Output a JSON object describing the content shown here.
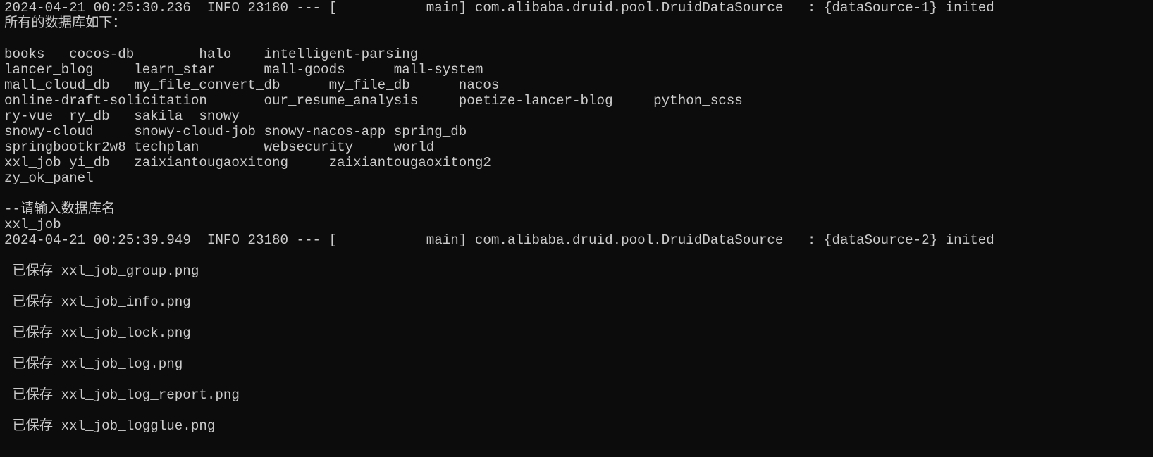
{
  "terminal": {
    "background": "#0c0c0c",
    "foreground": "#cccccc",
    "lines": [
      "2024-04-21 00:25:30.236  INFO 23180 --- [           main] com.alibaba.druid.pool.DruidDataSource   : {dataSource-1} inited",
      "所有的数据库如下：",
      "",
      "books   cocos-db        halo    intelligent-parsing",
      "lancer_blog     learn_star      mall-goods      mall-system",
      "mall_cloud_db   my_file_convert_db      my_file_db      nacos",
      "online-draft-solicitation       our_resume_analysis     poetize-lancer-blog     python_scss",
      "ry-vue  ry_db   sakila  snowy",
      "snowy-cloud     snowy-cloud-job snowy-nacos-app spring_db",
      "springbootkr2w8 techplan        websecurity     world",
      "xxl_job yi_db   zaixiantougaoxitong     zaixiantougaoxitong2",
      "zy_ok_panel",
      "",
      "--请输入数据库名",
      "xxl_job",
      "2024-04-21 00:25:39.949  INFO 23180 --- [           main] com.alibaba.druid.pool.DruidDataSource   : {dataSource-2} inited",
      "",
      " 已保存 xxl_job_group.png",
      "",
      " 已保存 xxl_job_info.png",
      "",
      " 已保存 xxl_job_lock.png",
      "",
      " 已保存 xxl_job_log.png",
      "",
      " 已保存 xxl_job_log_report.png",
      "",
      " 已保存 xxl_job_logglue.png"
    ]
  }
}
